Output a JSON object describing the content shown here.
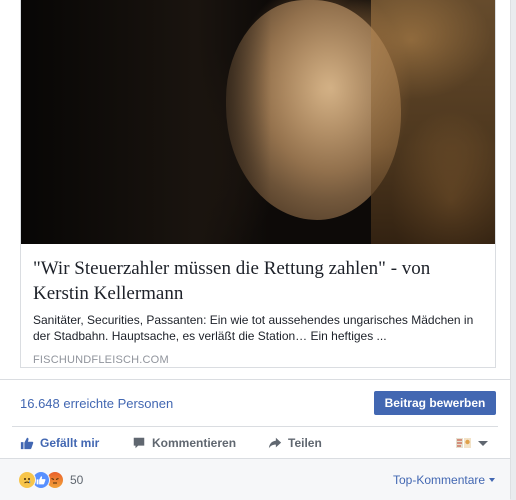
{
  "link_preview": {
    "title": "\"Wir Steuerzahler müssen die Rettung zahlen\" - von Kerstin Kellermann",
    "description": "Sanitäter, Securities, Passanten: Ein wie tot aussehendes ungarisches Mädchen in der Stadbahn. Hauptsache, es verläßt die Station… Ein heftiges ...",
    "domain": "FISCHUNDFLEISCH.COM"
  },
  "reach": {
    "text": "16.648 erreichte Personen",
    "promote_label": "Beitrag bewerben"
  },
  "actions": {
    "like_label": "Gefällt mir",
    "comment_label": "Kommentieren",
    "share_label": "Teilen"
  },
  "footer": {
    "reaction_count": "50",
    "sort_label": "Top-Kommentare"
  },
  "colors": {
    "brand_blue": "#4267b2",
    "muted_text": "#606770",
    "domain_text": "#90949c"
  },
  "icons": [
    "like-icon",
    "comment-icon",
    "share-icon",
    "page-avatar-icon",
    "chevron-down-icon",
    "sad-reaction-icon",
    "like-reaction-icon",
    "angry-reaction-icon"
  ]
}
